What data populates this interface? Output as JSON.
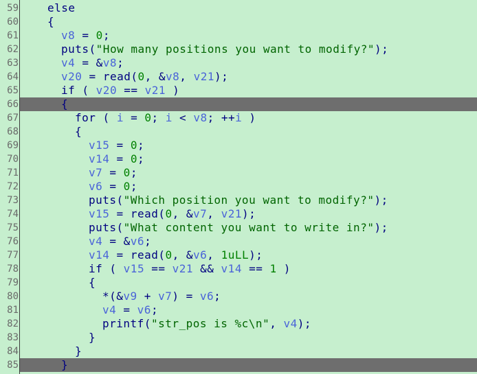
{
  "colors": {
    "background": "#c6efce",
    "highlight": "#6e6e6e",
    "line_number": "#6a6a6a",
    "keyword": "#000080",
    "variable": "#4a64d8",
    "string": "#006400",
    "number": "#008000"
  },
  "lines": [
    {
      "num": "59",
      "indent": 2,
      "tokens": [
        {
          "t": "else",
          "c": "kw"
        }
      ]
    },
    {
      "num": "60",
      "indent": 2,
      "tokens": [
        {
          "t": "{",
          "c": "p"
        }
      ]
    },
    {
      "num": "61",
      "indent": 3,
      "tokens": [
        {
          "t": "v8",
          "c": "v"
        },
        {
          "t": " = ",
          "c": "p"
        },
        {
          "t": "0",
          "c": "n"
        },
        {
          "t": ";",
          "c": "p"
        }
      ]
    },
    {
      "num": "62",
      "indent": 3,
      "tokens": [
        {
          "t": "puts",
          "c": "fn"
        },
        {
          "t": "(",
          "c": "p"
        },
        {
          "t": "\"How many positions you want to modify?\"",
          "c": "s"
        },
        {
          "t": ");",
          "c": "p"
        }
      ]
    },
    {
      "num": "63",
      "indent": 3,
      "tokens": [
        {
          "t": "v4",
          "c": "v"
        },
        {
          "t": " = &",
          "c": "p"
        },
        {
          "t": "v8",
          "c": "v"
        },
        {
          "t": ";",
          "c": "p"
        }
      ]
    },
    {
      "num": "64",
      "indent": 3,
      "tokens": [
        {
          "t": "v20",
          "c": "v"
        },
        {
          "t": " = ",
          "c": "p"
        },
        {
          "t": "read",
          "c": "fn"
        },
        {
          "t": "(",
          "c": "p"
        },
        {
          "t": "0",
          "c": "n"
        },
        {
          "t": ", &",
          "c": "p"
        },
        {
          "t": "v8",
          "c": "v"
        },
        {
          "t": ", ",
          "c": "p"
        },
        {
          "t": "v21",
          "c": "v"
        },
        {
          "t": ");",
          "c": "p"
        }
      ]
    },
    {
      "num": "65",
      "indent": 3,
      "tokens": [
        {
          "t": "if",
          "c": "kw"
        },
        {
          "t": " ( ",
          "c": "p"
        },
        {
          "t": "v20",
          "c": "v"
        },
        {
          "t": " == ",
          "c": "p"
        },
        {
          "t": "v21",
          "c": "v"
        },
        {
          "t": " )",
          "c": "p"
        }
      ]
    },
    {
      "num": "66",
      "indent": 3,
      "hl": true,
      "tokens": [
        {
          "t": "{",
          "c": "p"
        }
      ]
    },
    {
      "num": "67",
      "indent": 4,
      "tokens": [
        {
          "t": "for",
          "c": "kw"
        },
        {
          "t": " ( ",
          "c": "p"
        },
        {
          "t": "i",
          "c": "v"
        },
        {
          "t": " = ",
          "c": "p"
        },
        {
          "t": "0",
          "c": "n"
        },
        {
          "t": "; ",
          "c": "p"
        },
        {
          "t": "i",
          "c": "v"
        },
        {
          "t": " < ",
          "c": "p"
        },
        {
          "t": "v8",
          "c": "v"
        },
        {
          "t": "; ++",
          "c": "p"
        },
        {
          "t": "i",
          "c": "v"
        },
        {
          "t": " )",
          "c": "p"
        }
      ]
    },
    {
      "num": "68",
      "indent": 4,
      "tokens": [
        {
          "t": "{",
          "c": "p"
        }
      ]
    },
    {
      "num": "69",
      "indent": 5,
      "tokens": [
        {
          "t": "v15",
          "c": "v"
        },
        {
          "t": " = ",
          "c": "p"
        },
        {
          "t": "0",
          "c": "n"
        },
        {
          "t": ";",
          "c": "p"
        }
      ]
    },
    {
      "num": "70",
      "indent": 5,
      "tokens": [
        {
          "t": "v14",
          "c": "v"
        },
        {
          "t": " = ",
          "c": "p"
        },
        {
          "t": "0",
          "c": "n"
        },
        {
          "t": ";",
          "c": "p"
        }
      ]
    },
    {
      "num": "71",
      "indent": 5,
      "tokens": [
        {
          "t": "v7",
          "c": "v"
        },
        {
          "t": " = ",
          "c": "p"
        },
        {
          "t": "0",
          "c": "n"
        },
        {
          "t": ";",
          "c": "p"
        }
      ]
    },
    {
      "num": "72",
      "indent": 5,
      "tokens": [
        {
          "t": "v6",
          "c": "v"
        },
        {
          "t": " = ",
          "c": "p"
        },
        {
          "t": "0",
          "c": "n"
        },
        {
          "t": ";",
          "c": "p"
        }
      ]
    },
    {
      "num": "73",
      "indent": 5,
      "tokens": [
        {
          "t": "puts",
          "c": "fn"
        },
        {
          "t": "(",
          "c": "p"
        },
        {
          "t": "\"Which position you want to modify?\"",
          "c": "s"
        },
        {
          "t": ");",
          "c": "p"
        }
      ]
    },
    {
      "num": "74",
      "indent": 5,
      "tokens": [
        {
          "t": "v15",
          "c": "v"
        },
        {
          "t": " = ",
          "c": "p"
        },
        {
          "t": "read",
          "c": "fn"
        },
        {
          "t": "(",
          "c": "p"
        },
        {
          "t": "0",
          "c": "n"
        },
        {
          "t": ", &",
          "c": "p"
        },
        {
          "t": "v7",
          "c": "v"
        },
        {
          "t": ", ",
          "c": "p"
        },
        {
          "t": "v21",
          "c": "v"
        },
        {
          "t": ");",
          "c": "p"
        }
      ]
    },
    {
      "num": "75",
      "indent": 5,
      "tokens": [
        {
          "t": "puts",
          "c": "fn"
        },
        {
          "t": "(",
          "c": "p"
        },
        {
          "t": "\"What content you want to write in?\"",
          "c": "s"
        },
        {
          "t": ");",
          "c": "p"
        }
      ]
    },
    {
      "num": "76",
      "indent": 5,
      "tokens": [
        {
          "t": "v4",
          "c": "v"
        },
        {
          "t": " = &",
          "c": "p"
        },
        {
          "t": "v6",
          "c": "v"
        },
        {
          "t": ";",
          "c": "p"
        }
      ]
    },
    {
      "num": "77",
      "indent": 5,
      "tokens": [
        {
          "t": "v14",
          "c": "v"
        },
        {
          "t": " = ",
          "c": "p"
        },
        {
          "t": "read",
          "c": "fn"
        },
        {
          "t": "(",
          "c": "p"
        },
        {
          "t": "0",
          "c": "n"
        },
        {
          "t": ", &",
          "c": "p"
        },
        {
          "t": "v6",
          "c": "v"
        },
        {
          "t": ", ",
          "c": "p"
        },
        {
          "t": "1uLL",
          "c": "n"
        },
        {
          "t": ");",
          "c": "p"
        }
      ]
    },
    {
      "num": "78",
      "indent": 5,
      "tokens": [
        {
          "t": "if",
          "c": "kw"
        },
        {
          "t": " ( ",
          "c": "p"
        },
        {
          "t": "v15",
          "c": "v"
        },
        {
          "t": " == ",
          "c": "p"
        },
        {
          "t": "v21",
          "c": "v"
        },
        {
          "t": " && ",
          "c": "p"
        },
        {
          "t": "v14",
          "c": "v"
        },
        {
          "t": " == ",
          "c": "p"
        },
        {
          "t": "1",
          "c": "n"
        },
        {
          "t": " )",
          "c": "p"
        }
      ]
    },
    {
      "num": "79",
      "indent": 5,
      "tokens": [
        {
          "t": "{",
          "c": "p"
        }
      ]
    },
    {
      "num": "80",
      "indent": 6,
      "tokens": [
        {
          "t": "*(&",
          "c": "p"
        },
        {
          "t": "v9",
          "c": "v"
        },
        {
          "t": " + ",
          "c": "p"
        },
        {
          "t": "v7",
          "c": "v"
        },
        {
          "t": ") = ",
          "c": "p"
        },
        {
          "t": "v6",
          "c": "v"
        },
        {
          "t": ";",
          "c": "p"
        }
      ]
    },
    {
      "num": "81",
      "indent": 6,
      "tokens": [
        {
          "t": "v4",
          "c": "v"
        },
        {
          "t": " = ",
          "c": "p"
        },
        {
          "t": "v6",
          "c": "v"
        },
        {
          "t": ";",
          "c": "p"
        }
      ]
    },
    {
      "num": "82",
      "indent": 6,
      "tokens": [
        {
          "t": "printf",
          "c": "fn"
        },
        {
          "t": "(",
          "c": "p"
        },
        {
          "t": "\"str_pos is %c\\n\"",
          "c": "s"
        },
        {
          "t": ", ",
          "c": "p"
        },
        {
          "t": "v4",
          "c": "v"
        },
        {
          "t": ");",
          "c": "p"
        }
      ]
    },
    {
      "num": "83",
      "indent": 5,
      "tokens": [
        {
          "t": "}",
          "c": "p"
        }
      ]
    },
    {
      "num": "84",
      "indent": 4,
      "tokens": [
        {
          "t": "}",
          "c": "p"
        }
      ]
    },
    {
      "num": "85",
      "indent": 3,
      "hl": true,
      "tokens": [
        {
          "t": "}",
          "c": "p"
        }
      ]
    }
  ]
}
